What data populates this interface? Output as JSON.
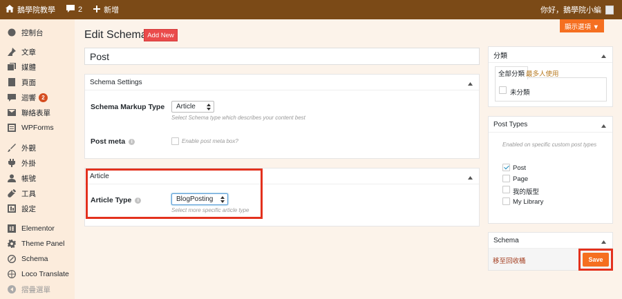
{
  "adminbar": {
    "site_name": "鵝學院教學",
    "comments_count": "2",
    "new_label": "新增",
    "greeting": "你好，鵝學院小編"
  },
  "sidebar": {
    "items": [
      {
        "label": "控制台",
        "icon": "dashboard-icon"
      },
      {
        "label": "文章",
        "icon": "pin-icon"
      },
      {
        "label": "媒體",
        "icon": "media-icon"
      },
      {
        "label": "頁面",
        "icon": "page-icon"
      },
      {
        "label": "迴響",
        "icon": "comment-icon",
        "badge": "2"
      },
      {
        "label": "聯絡表單",
        "icon": "mail-icon"
      },
      {
        "label": "WPForms",
        "icon": "form-icon"
      },
      {
        "label": "外觀",
        "icon": "brush-icon"
      },
      {
        "label": "外掛",
        "icon": "plugin-icon"
      },
      {
        "label": "帳號",
        "icon": "user-icon"
      },
      {
        "label": "工具",
        "icon": "wrench-icon"
      },
      {
        "label": "設定",
        "icon": "settings-icon"
      },
      {
        "label": "Elementor",
        "icon": "elementor-icon"
      },
      {
        "label": "Theme Panel",
        "icon": "gear-icon"
      },
      {
        "label": "Schema",
        "icon": "schema-icon"
      },
      {
        "label": "Loco Translate",
        "icon": "globe-icon"
      },
      {
        "label": "摺疊選單",
        "icon": "collapse-icon"
      }
    ]
  },
  "screen_options_label": "顯示選項 ▼",
  "page": {
    "title": "Edit Schema",
    "add_new": "Add New",
    "post_title": "Post"
  },
  "schema_settings": {
    "heading": "Schema Settings",
    "markup_type_label": "Schema Markup Type",
    "markup_type_value": "Article",
    "markup_type_hint": "Select Schema type which describes your content best",
    "post_meta_label": "Post meta",
    "post_meta_checkbox": "Enable post meta box?"
  },
  "article": {
    "heading": "Article",
    "type_label": "Article Type",
    "type_value": "BlogPosting",
    "type_hint": "Select more specific article type"
  },
  "categories": {
    "heading": "分類",
    "tab_all": "全部分類",
    "tab_popular": "最多人使用",
    "uncategorized": "未分類"
  },
  "post_types": {
    "heading": "Post Types",
    "description": "Enabled on specific custom post types",
    "options": [
      {
        "label": "Post",
        "checked": true
      },
      {
        "label": "Page",
        "checked": false
      },
      {
        "label": "我的版型",
        "checked": false
      },
      {
        "label": "My Library",
        "checked": false
      }
    ]
  },
  "publish": {
    "heading": "Schema",
    "trash_link": "移至回收桶",
    "save_label": "Save"
  },
  "colors": {
    "adminbar": "#7b4a17",
    "sidebar": "#fcecdc",
    "accent": "#f56f20",
    "highlight": "#e3311d"
  }
}
